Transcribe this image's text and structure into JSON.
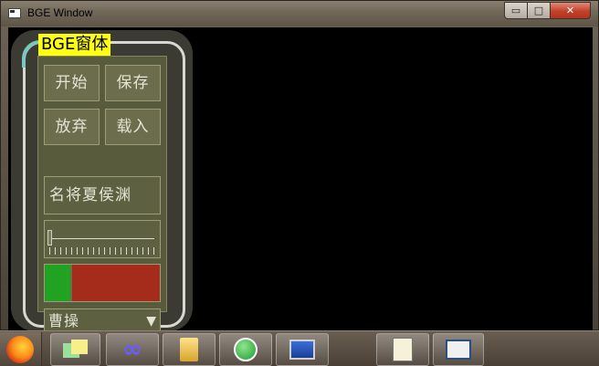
{
  "window": {
    "title": "BGE Window",
    "controls": {
      "minimize": "▭",
      "maximize": "□",
      "close": "✕"
    }
  },
  "panel": {
    "title": "BGE窗体",
    "buttons": {
      "start": "开始",
      "save": "保存",
      "abandon": "放弃",
      "load": "载入"
    },
    "name_field": {
      "value": "名将夏侯渊"
    },
    "slider": {
      "value": 0,
      "tick_count": 20
    },
    "progress": {
      "value_percent": 24,
      "fill_color": "#21a220",
      "track_color": "#a52b1b"
    },
    "combo": {
      "selected": "曹操",
      "arrow": "▼"
    }
  },
  "colors": {
    "panel_bg": "#595c3c",
    "panel_label_bg": "#ffff10",
    "ring_accent": "#77c9c0"
  },
  "taskbar": {
    "items": [
      {
        "name": "firefox-icon"
      },
      {
        "name": "sticky-notes-icon"
      },
      {
        "name": "infinity-icon"
      },
      {
        "name": "folder-icon"
      },
      {
        "name": "pen-icon"
      },
      {
        "name": "remote-desktop-icon"
      },
      {
        "name": "notepad-icon"
      },
      {
        "name": "window-app-icon"
      }
    ]
  }
}
